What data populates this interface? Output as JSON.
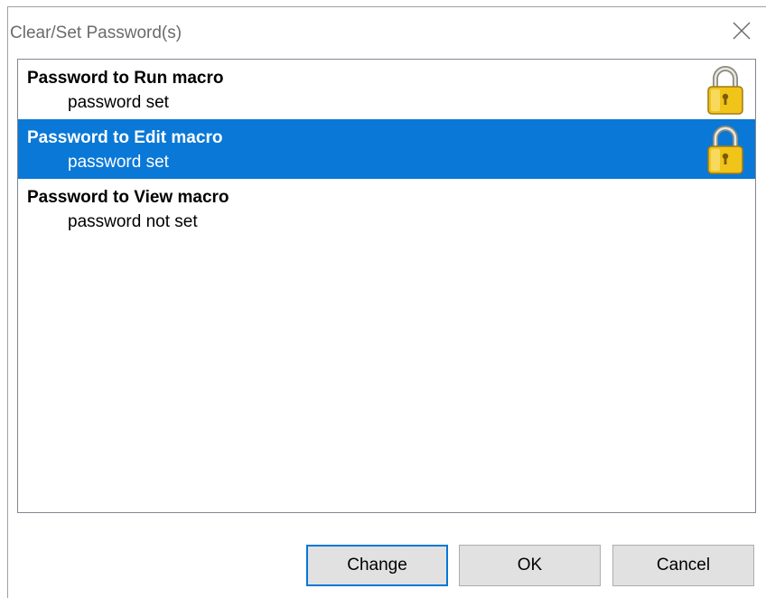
{
  "window": {
    "title": "Clear/Set Password(s)",
    "close_icon": "close-icon"
  },
  "passwords": [
    {
      "name": "Password to Run macro",
      "status": "password set",
      "locked": true,
      "selected": false
    },
    {
      "name": "Password to Edit macro",
      "status": "password set",
      "locked": true,
      "selected": true
    },
    {
      "name": "Password to View macro",
      "status": "password not set",
      "locked": false,
      "selected": false
    }
  ],
  "buttons": {
    "change": "Change",
    "ok": "OK",
    "cancel": "Cancel"
  },
  "colors": {
    "selection": "#0a78d7",
    "lock_gold": "#f0c419"
  }
}
